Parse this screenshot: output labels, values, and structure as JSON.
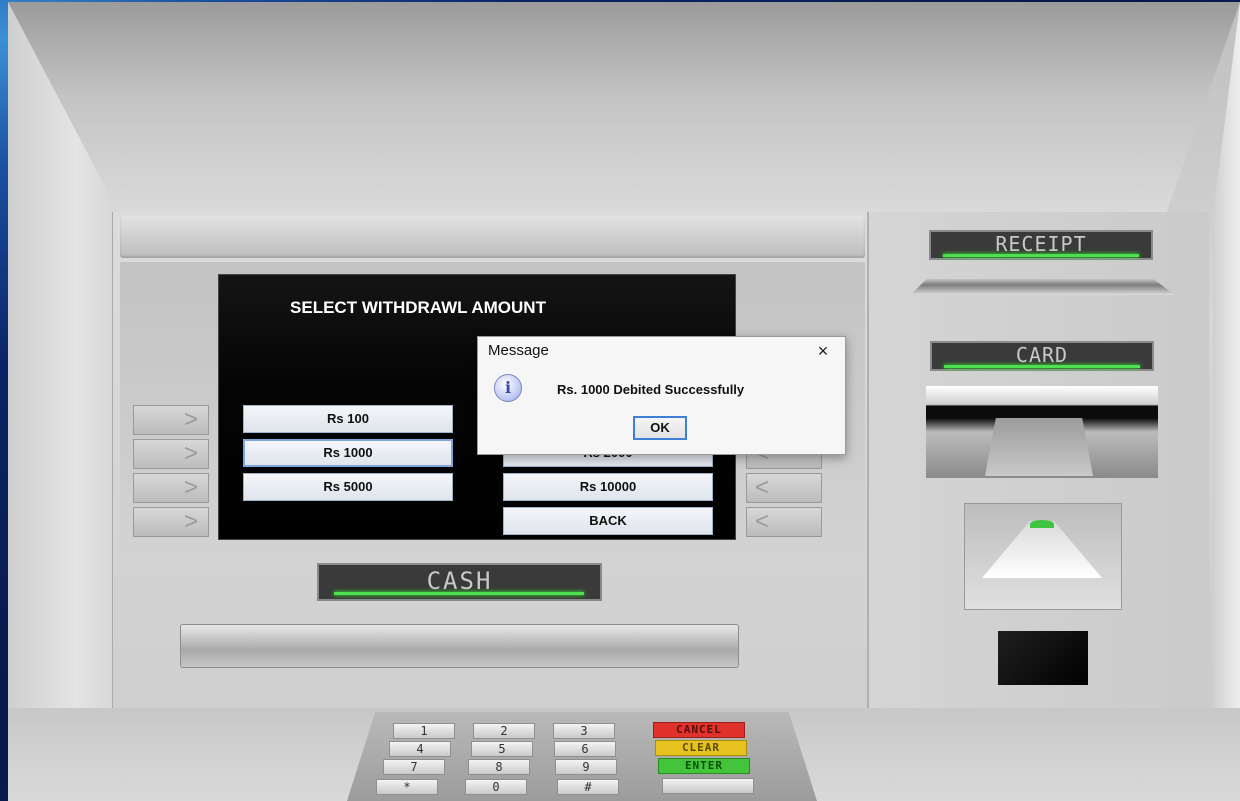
{
  "screen": {
    "title": "SELECT WITHDRAWL AMOUNT",
    "options_left": [
      "Rs 100",
      "Rs 1000",
      "Rs 5000"
    ],
    "options_right": [
      "Rs 2000",
      "Rs 10000",
      "BACK"
    ]
  },
  "side_keys": {
    "left_glyph": ">",
    "right_glyph": "<"
  },
  "labels": {
    "receipt": "RECEIPT",
    "card": "CARD",
    "cash": "CASH"
  },
  "keypad": {
    "rows": [
      [
        "1",
        "2",
        "3",
        "CANCEL"
      ],
      [
        "4",
        "5",
        "6",
        "CLEAR"
      ],
      [
        "7",
        "8",
        "9",
        "ENTER"
      ],
      [
        "*",
        "0",
        "#",
        ""
      ]
    ],
    "colors": {
      "cancel": "#e0312b",
      "clear": "#e6c21e",
      "enter": "#43c43a"
    }
  },
  "dialog": {
    "title": "Message",
    "close_glyph": "×",
    "icon": "info-icon",
    "icon_glyph": "i",
    "message": "Rs. 1000 Debited Successfully",
    "ok_label": "OK"
  },
  "colors": {
    "indicator_green": "#4fe04f",
    "screen_bg": "#000000",
    "display_bg": "#3a3a3a"
  }
}
